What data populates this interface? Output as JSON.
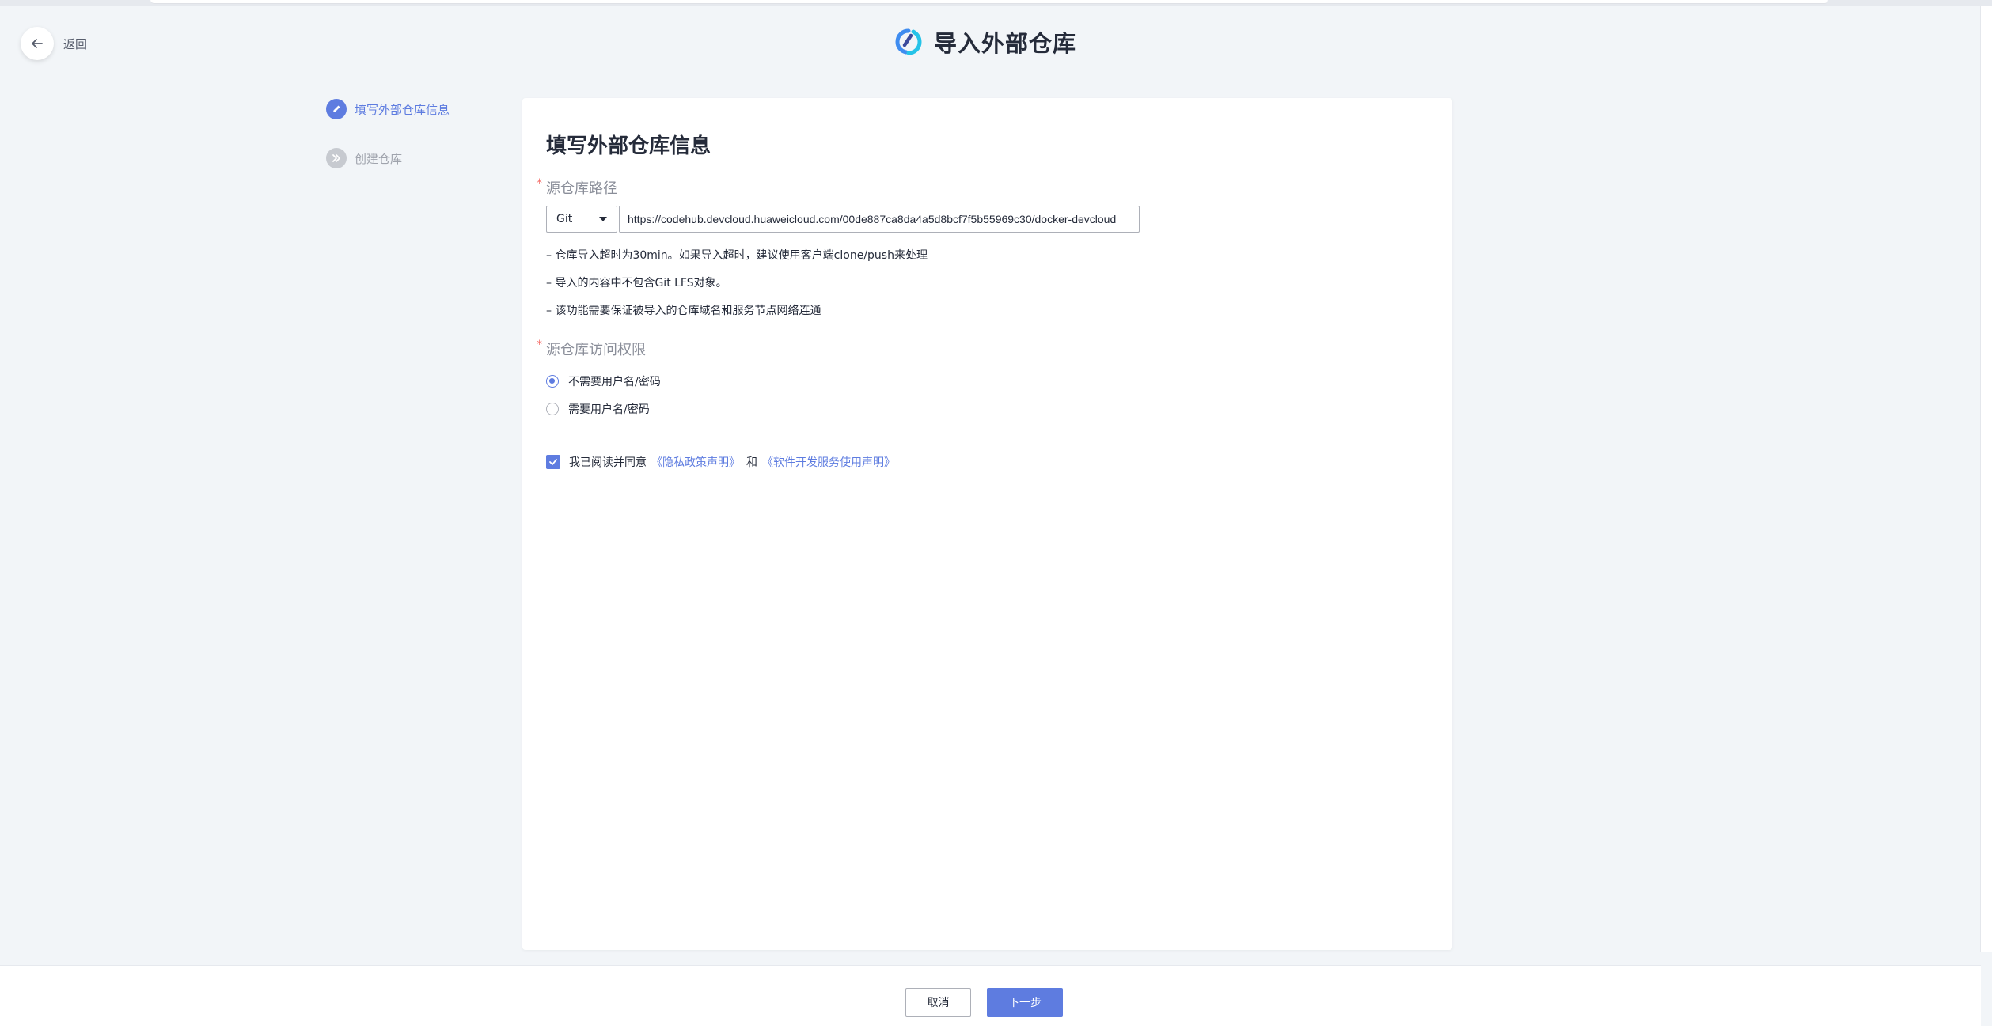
{
  "nav": {
    "back_label": "返回"
  },
  "header": {
    "title": "导入外部仓库",
    "logo_icon": "devcloud-logo-icon"
  },
  "steps": [
    {
      "label": "填写外部仓库信息",
      "state": "active",
      "icon": "pencil-icon"
    },
    {
      "label": "创建仓库",
      "state": "todo",
      "icon": "double-chevron-right-icon"
    }
  ],
  "form": {
    "title": "填写外部仓库信息",
    "source_path": {
      "label": "源仓库路径",
      "type_value": "Git",
      "url_value": "https://codehub.devcloud.huaweicloud.com/00de887ca8da4a5d8bcf7f5b55969c30/docker-devcloud"
    },
    "notes": [
      "– 仓库导入超时为30min。如果导入超时，建议使用客户端clone/push来处理",
      "– 导入的内容中不包含Git LFS对象。",
      "– 该功能需要保证被导入的仓库域名和服务节点网络连通"
    ],
    "access": {
      "label": "源仓库访问权限",
      "options": [
        "不需要用户名/密码",
        "需要用户名/密码"
      ],
      "selected": 0
    },
    "agreement": {
      "text": "我已阅读并同意",
      "privacy_link": "《隐私政策声明》",
      "and": "和",
      "service_link": "《软件开发服务使用声明》",
      "checked": true
    }
  },
  "footer": {
    "cancel_label": "取消",
    "next_label": "下一步"
  },
  "colors": {
    "accent": "#5e7ce0",
    "required": "#f66f6a",
    "background": "#f2f5f8"
  }
}
